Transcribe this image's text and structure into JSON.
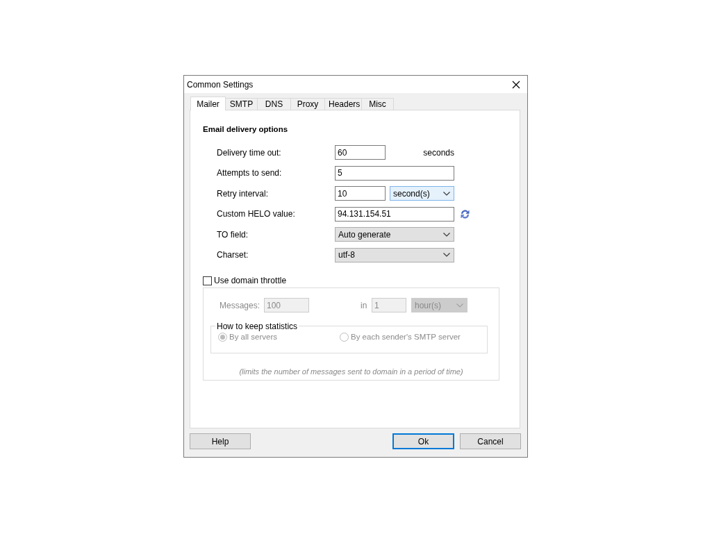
{
  "window": {
    "title": "Common Settings"
  },
  "tabs": [
    {
      "label": "Mailer",
      "selected": true
    },
    {
      "label": "SMTP",
      "selected": false
    },
    {
      "label": "DNS",
      "selected": false
    },
    {
      "label": "Proxy",
      "selected": false
    },
    {
      "label": "Headers",
      "selected": false
    },
    {
      "label": "Misc",
      "selected": false
    }
  ],
  "section_title": "Email delivery options",
  "fields": [
    {
      "kind": "text",
      "label": "Delivery time out:",
      "value": "60",
      "suffix": "seconds"
    },
    {
      "kind": "text",
      "label": "Attempts to send:",
      "value": "5"
    },
    {
      "kind": "text_select",
      "label": "Retry interval:",
      "value": "10",
      "option": "second(s)",
      "focused": true
    },
    {
      "kind": "text_refresh",
      "label": "Custom HELO value:",
      "value": "94.131.154.51"
    },
    {
      "kind": "select",
      "label": "TO field:",
      "value": "Auto generate"
    },
    {
      "kind": "select",
      "label": "Charset:",
      "value": "utf-8"
    }
  ],
  "throttle": {
    "label": "Use domain throttle",
    "checked": false,
    "messages_label": "Messages:",
    "messages_value": "100",
    "in_label": "in",
    "period_value": "1",
    "period_unit": "hour(s)",
    "stats": {
      "title": "How to keep statistics",
      "options": [
        {
          "label": "By all servers",
          "selected": true
        },
        {
          "label": "By each sender's SMTP server",
          "selected": false
        }
      ]
    },
    "note": "(limits the number of messages sent to domain in a period of time)"
  },
  "buttons": [
    {
      "label": "Help",
      "default": false
    },
    {
      "label": "Ok",
      "default": true
    },
    {
      "label": "Cancel",
      "default": false
    }
  ]
}
